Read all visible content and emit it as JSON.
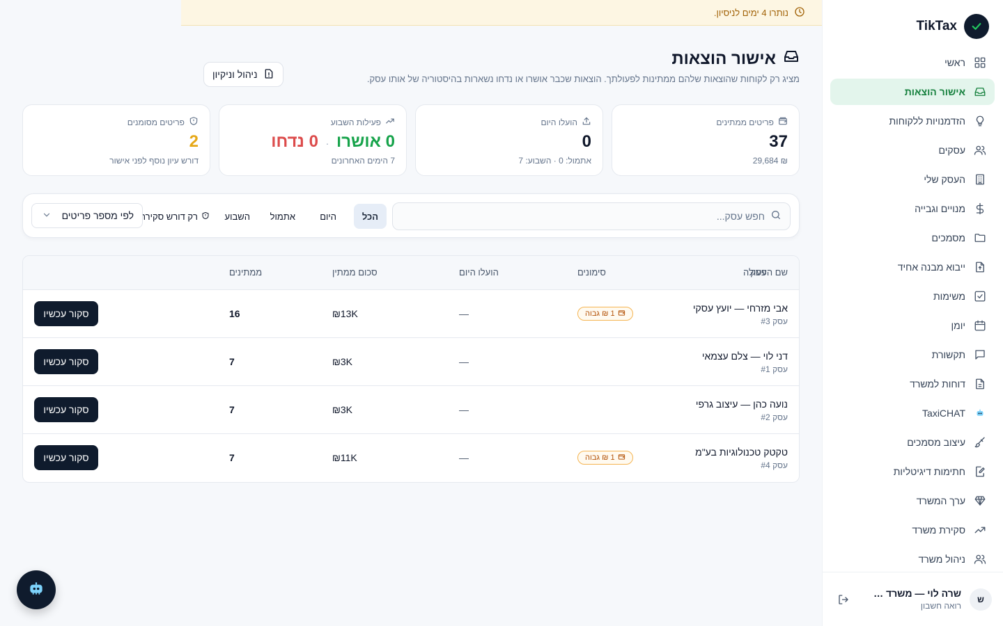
{
  "brand": {
    "name": "TikTax"
  },
  "trial_banner": {
    "text": "נותרו 4 ימים לניסיון."
  },
  "nav": [
    {
      "label": "ראשי",
      "icon": "grid-icon"
    },
    {
      "label": "אישור הוצאות",
      "icon": "inbox-icon",
      "active": true
    },
    {
      "label": "הזדמנויות ללקוחות",
      "icon": "lightbulb-icon"
    },
    {
      "label": "עסקים",
      "icon": "users-icon"
    },
    {
      "label": "העסק שלי",
      "icon": "building-icon"
    },
    {
      "label": "מנויים וגבייה",
      "icon": "dollar-icon"
    },
    {
      "label": "מסמכים",
      "icon": "folder-icon"
    },
    {
      "label": "ייבוא מבנה אחיד",
      "icon": "file-upload-icon"
    },
    {
      "label": "משימות",
      "icon": "checkbox-icon"
    },
    {
      "label": "יומן",
      "icon": "calendar-icon"
    },
    {
      "label": "תקשורת",
      "icon": "message-icon"
    },
    {
      "label": "דוחות למשרד",
      "icon": "report-icon"
    },
    {
      "label": "TaxiCHAT",
      "icon": "bot-icon"
    },
    {
      "label": "עיצוב מסמכים",
      "icon": "brush-icon"
    },
    {
      "label": "חתימות דיגיטליות",
      "icon": "signature-icon"
    },
    {
      "label": "ערך המשרד",
      "icon": "diamond-icon"
    },
    {
      "label": "סקירת משרד",
      "icon": "trend-icon"
    },
    {
      "label": "ניהול משרד",
      "icon": "team-icon"
    }
  ],
  "user": {
    "name": "שרה לוי — משרד רו...",
    "role": "רואה חשבון",
    "initial": "ש"
  },
  "page": {
    "title": "אישור הוצאות",
    "subtitle": "מציג רק לקוחות שהוצאות שלהם ממתינות לפעולתך. הוצאות שכבר אושרו או נדחו נשארות בהיסטוריה של אותו עסק.",
    "manage_label": "ניהול וניקיון"
  },
  "stats": {
    "pending": {
      "label": "פריטים ממתינים",
      "value": "37",
      "foot": "₪ 29,684"
    },
    "today": {
      "label": "הועלו היום",
      "value": "0",
      "foot": "אתמול: 0 · השבוע: 7"
    },
    "week": {
      "label": "פעילות השבוע",
      "approved": "0 אושרו",
      "sep": "·",
      "rejected": "0 נדחו",
      "foot": "7 הימים האחרונים"
    },
    "flagged": {
      "label": "פריטים מסומנים",
      "value": "2",
      "foot": "דורש עיון נוסף לפני אישור"
    }
  },
  "filters": {
    "search_placeholder": "חפש עסק...",
    "chips": [
      "הכל",
      "היום",
      "אתמול",
      "השבוע"
    ],
    "review_only": "רק דורש סקירה",
    "sort_label": "לפי מספר פריטים"
  },
  "table": {
    "headers": {
      "business": "שם העסק",
      "pending": "ממתינים",
      "amount": "סכום ממתין",
      "today": "הועלו היום",
      "flags": "סימונים",
      "action": "פעולה"
    },
    "rows": [
      {
        "name": "אבי מזרחי — יועץ עסקי",
        "id": "עסק #3",
        "pending": "16",
        "amount": "₪13K",
        "today": "—",
        "badge": "1 ₪ גבוה",
        "action": "סקור עכשיו"
      },
      {
        "name": "דני לוי — צלם עצמאי",
        "id": "עסק #1",
        "pending": "7",
        "amount": "₪3K",
        "today": "—",
        "badge": "",
        "action": "סקור עכשיו"
      },
      {
        "name": "נועה כהן — עיצוב גרפי",
        "id": "עסק #2",
        "pending": "7",
        "amount": "₪3K",
        "today": "—",
        "badge": "",
        "action": "סקור עכשיו"
      },
      {
        "name": "טקטק טכנולוגיות בע\"מ",
        "id": "עסק #4",
        "pending": "7",
        "amount": "₪11K",
        "today": "—",
        "badge": "1 ₪ גבוה",
        "action": "סקור עכשיו"
      }
    ]
  },
  "colors": {
    "accent": "#15803d",
    "approved": "#16a34a",
    "rejected": "#dc4b4b",
    "flagged": "#e6a817",
    "dark": "#0f1b2d"
  }
}
